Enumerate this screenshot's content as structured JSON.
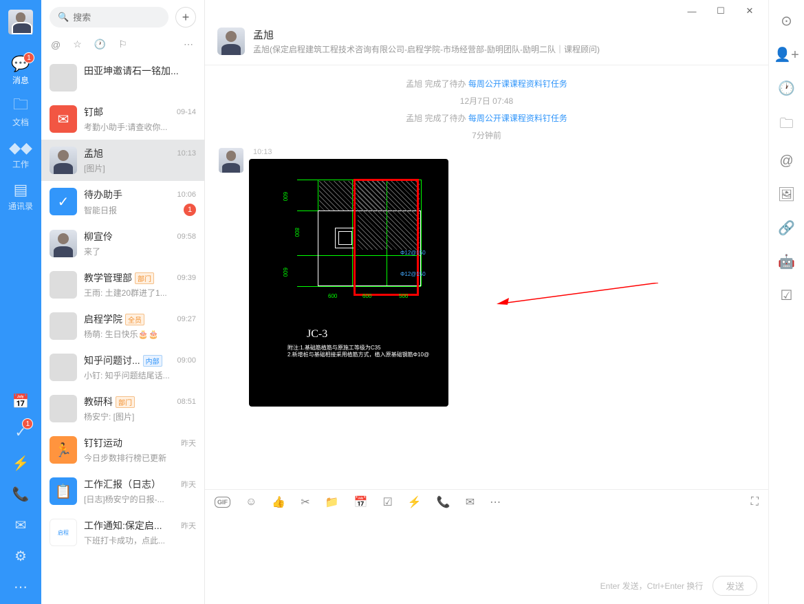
{
  "nav": {
    "items": [
      {
        "label": "消息",
        "icon": "💬",
        "badge": "1"
      },
      {
        "label": "文档",
        "icon": "📁",
        "badge": null
      },
      {
        "label": "工作",
        "icon": "🔷",
        "badge": null
      },
      {
        "label": "通讯录",
        "icon": "📘",
        "badge": null
      }
    ],
    "bottom_badge": "1"
  },
  "search": {
    "placeholder": "搜索"
  },
  "chats": [
    {
      "name": "田亚坤邀请石一铭加...",
      "preview": "",
      "time": "",
      "avatar": "group"
    },
    {
      "name": "钉邮",
      "preview": "考勤小助手:请查收你...",
      "time": "09-14",
      "avatar": "red",
      "icon": "✉"
    },
    {
      "name": "孟旭",
      "preview": "[图片]",
      "time": "10:13",
      "avatar": "person",
      "selected": true
    },
    {
      "name": "待办助手",
      "preview": "智能日报",
      "time": "10:06",
      "avatar": "blue",
      "icon": "✓",
      "unread": "1"
    },
    {
      "name": "柳宣伶",
      "preview": "来了",
      "time": "09:58",
      "avatar": "person"
    },
    {
      "name": "教学管理部",
      "tag": "部门",
      "preview": "王雨: 土建20群进了1...",
      "time": "09:39",
      "avatar": "group"
    },
    {
      "name": "启程学院",
      "tag": "全员",
      "tagClass": "",
      "preview": "杨萌: 生日快乐🎂🎂",
      "time": "09:27",
      "avatar": "group"
    },
    {
      "name": "知乎问题讨...",
      "tag": "内部",
      "tagClass": "blue",
      "preview": "小钉: 知乎问题结尾话...",
      "time": "09:00",
      "avatar": "group"
    },
    {
      "name": "教研科",
      "tag": "部门",
      "preview": "杨安宁: [图片]",
      "time": "08:51",
      "avatar": "group"
    },
    {
      "name": "钉钉运动",
      "preview": "今日步数排行榜已更新",
      "time": "昨天",
      "avatar": "orange",
      "icon": "🏃"
    },
    {
      "name": "工作汇报（日志）",
      "preview": "[日志]杨安宁的日报-...",
      "time": "昨天",
      "avatar": "blue",
      "icon": "📋"
    },
    {
      "name": "工作通知:保定启...",
      "preview": "下班打卡成功，点此...",
      "time": "昨天",
      "avatar": "logo"
    }
  ],
  "header": {
    "name": "孟旭",
    "sub": "孟旭(保定启程建筑工程技术咨询有限公司-启程学院-市场经营部-励明团队-励明二队｜课程顾问)"
  },
  "messages": {
    "sys1_pre": "孟旭 完成了待办 ",
    "sys1_link": "每周公开课课程资料钉任务",
    "date": "12月7日 07:48",
    "sys2_pre": "孟旭 完成了待办 ",
    "sys2_link": "每周公开课课程资料钉任务",
    "time_ago": "7分钟前",
    "msg_time": "10:13",
    "cad": {
      "title": "JC-3",
      "note1": "附注:1.基础筋植筋与原施工等级为C35",
      "note2": "2.新增桩与基础相接采用植筋方式，植入原基础钢筋Φ10@",
      "dim_600_1": "600",
      "dim_800": "800",
      "dim_600_2": "600",
      "dim_b_600_1": "600",
      "dim_b_600_2": "600",
      "dim_b_500": "500",
      "rebar1": "Φ12@150",
      "rebar2": "Φ12@150"
    }
  },
  "input": {
    "hint": "Enter 发送，Ctrl+Enter 换行",
    "send": "发送"
  }
}
